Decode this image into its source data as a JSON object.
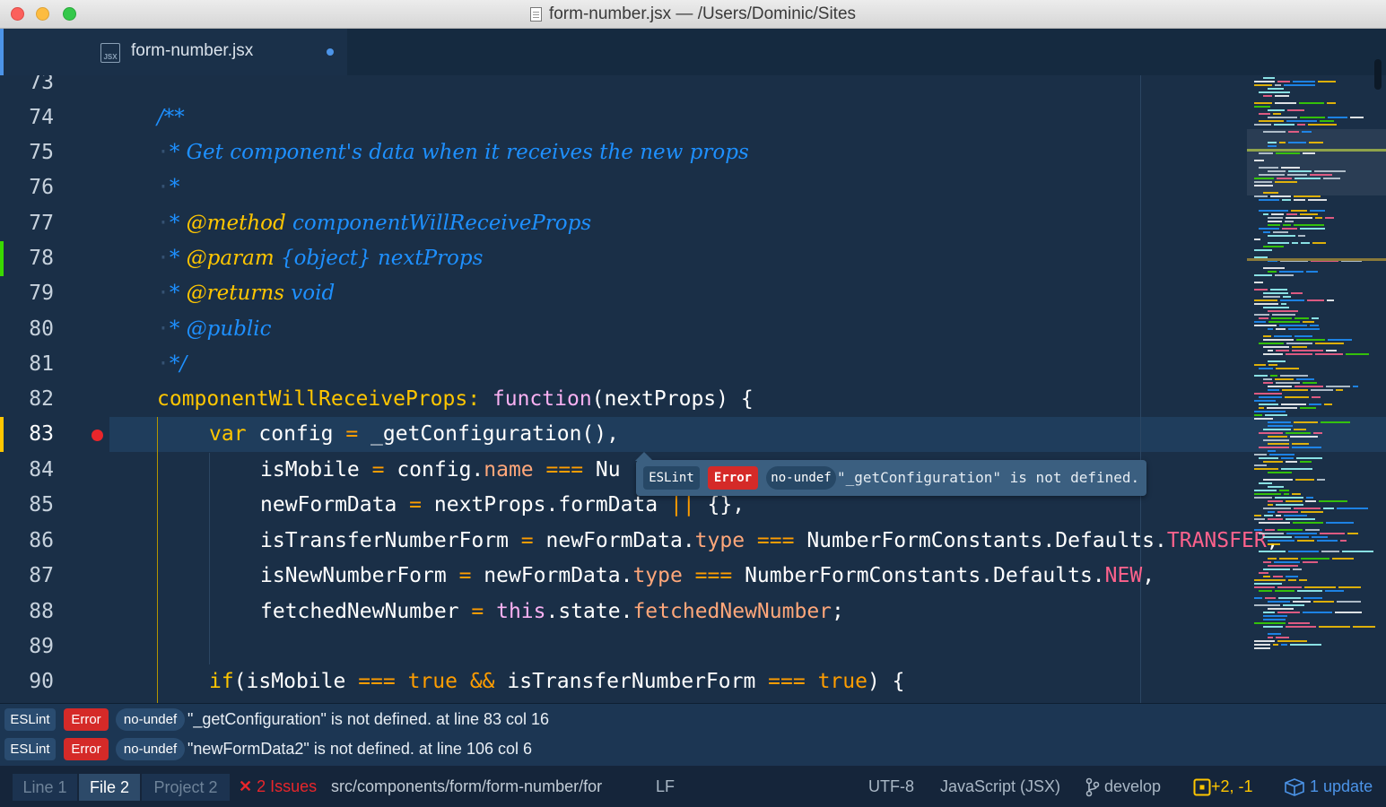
{
  "window": {
    "title": "form-number.jsx — /Users/Dominic/Sites"
  },
  "tab": {
    "label": "form-number.jsx",
    "icon_text": "JSX"
  },
  "gutter": {
    "line_numbers": [
      "73",
      "74",
      "75",
      "76",
      "77",
      "78",
      "79",
      "80",
      "81",
      "82",
      "83",
      "84",
      "85",
      "86",
      "87",
      "88",
      "89",
      "90"
    ],
    "current_line": "83"
  },
  "code": {
    "l74": "/**",
    "l75_star": "* ",
    "l75": "Get component's data when it receives the new props",
    "l76": "*",
    "l77_star": "* ",
    "l77_tag": "@method",
    "l77_rest": " componentWillReceiveProps",
    "l78_star": "* ",
    "l78_tag": "@param",
    "l78_rest": " {object} nextProps",
    "l79_star": "* ",
    "l79_tag": "@returns",
    "l79_rest": " void",
    "l80_star": "* ",
    "l80_tag": "@public",
    "l81": "*/",
    "l82_name": "componentWillReceiveProps",
    "l82_colon": ": ",
    "l82_fn": "function",
    "l82_rest": "(nextProps) {",
    "l83_kw": "var",
    "l83_a": " config ",
    "l83_eq": "=",
    "l83_b": " _getConfiguration(),",
    "l84_a": "isMobile ",
    "l84_eq": "=",
    "l84_b": " config.",
    "l84_prop": "name",
    "l84_op": " === ",
    "l84_c": "Nu",
    "l85_a": "newFormData ",
    "l85_eq": "=",
    "l85_b": " nextProps.formData ",
    "l85_op": "||",
    "l85_c": " {},",
    "l86_a": "isTransferNumberForm ",
    "l86_eq": "=",
    "l86_b": " newFormData.",
    "l86_prop": "type",
    "l86_op": " === ",
    "l86_c": "NumberFormConstants.Defaults.",
    "l86_const": "TRANSFER",
    "l86_d": ",",
    "l87_a": "isNewNumberForm ",
    "l87_eq": "=",
    "l87_b": " newFormData.",
    "l87_prop": "type",
    "l87_op": " === ",
    "l87_c": "NumberFormConstants.Defaults.",
    "l87_const": "NEW",
    "l87_d": ",",
    "l88_a": "fetchedNewNumber ",
    "l88_eq": "=",
    "l88_this": " this",
    "l88_b": ".state.",
    "l88_prop": "fetchedNewNumber",
    "l88_c": ";",
    "l90_kw": "if",
    "l90_a": "(isMobile ",
    "l90_op1": "===",
    "l90_bool1": " true ",
    "l90_op2": "&&",
    "l90_b": " isTransferNumberForm ",
    "l90_op3": "===",
    "l90_bool2": " true",
    "l90_c": ") {"
  },
  "tooltip": {
    "linter": "ESLint",
    "severity": "Error",
    "rule": "no-undef",
    "message": "\"_getConfiguration\" is not defined."
  },
  "linter_panel": {
    "rows": [
      {
        "linter": "ESLint",
        "severity": "Error",
        "rule": "no-undef",
        "message": "\"_getConfiguration\" is not defined. at line 83 col 16"
      },
      {
        "linter": "ESLint",
        "severity": "Error",
        "rule": "no-undef",
        "message": "\"newFormData2\" is not defined. at line 106 col 6"
      }
    ]
  },
  "status": {
    "scope_line": "Line 1",
    "scope_file": "File 2",
    "scope_project": "Project 2",
    "issues": "2 Issues",
    "path": "src/components/form/form-number/for",
    "line_ending": "LF",
    "encoding": "UTF-8",
    "grammar": "JavaScript (JSX)",
    "branch": "develop",
    "diff": "+2, -1",
    "updates": "1 update"
  },
  "colors": {
    "background": "#1a2f47",
    "comment": "#1e90ff",
    "keyword": "#ffc600",
    "error": "#d52a28",
    "accent": "#4c94e8"
  }
}
